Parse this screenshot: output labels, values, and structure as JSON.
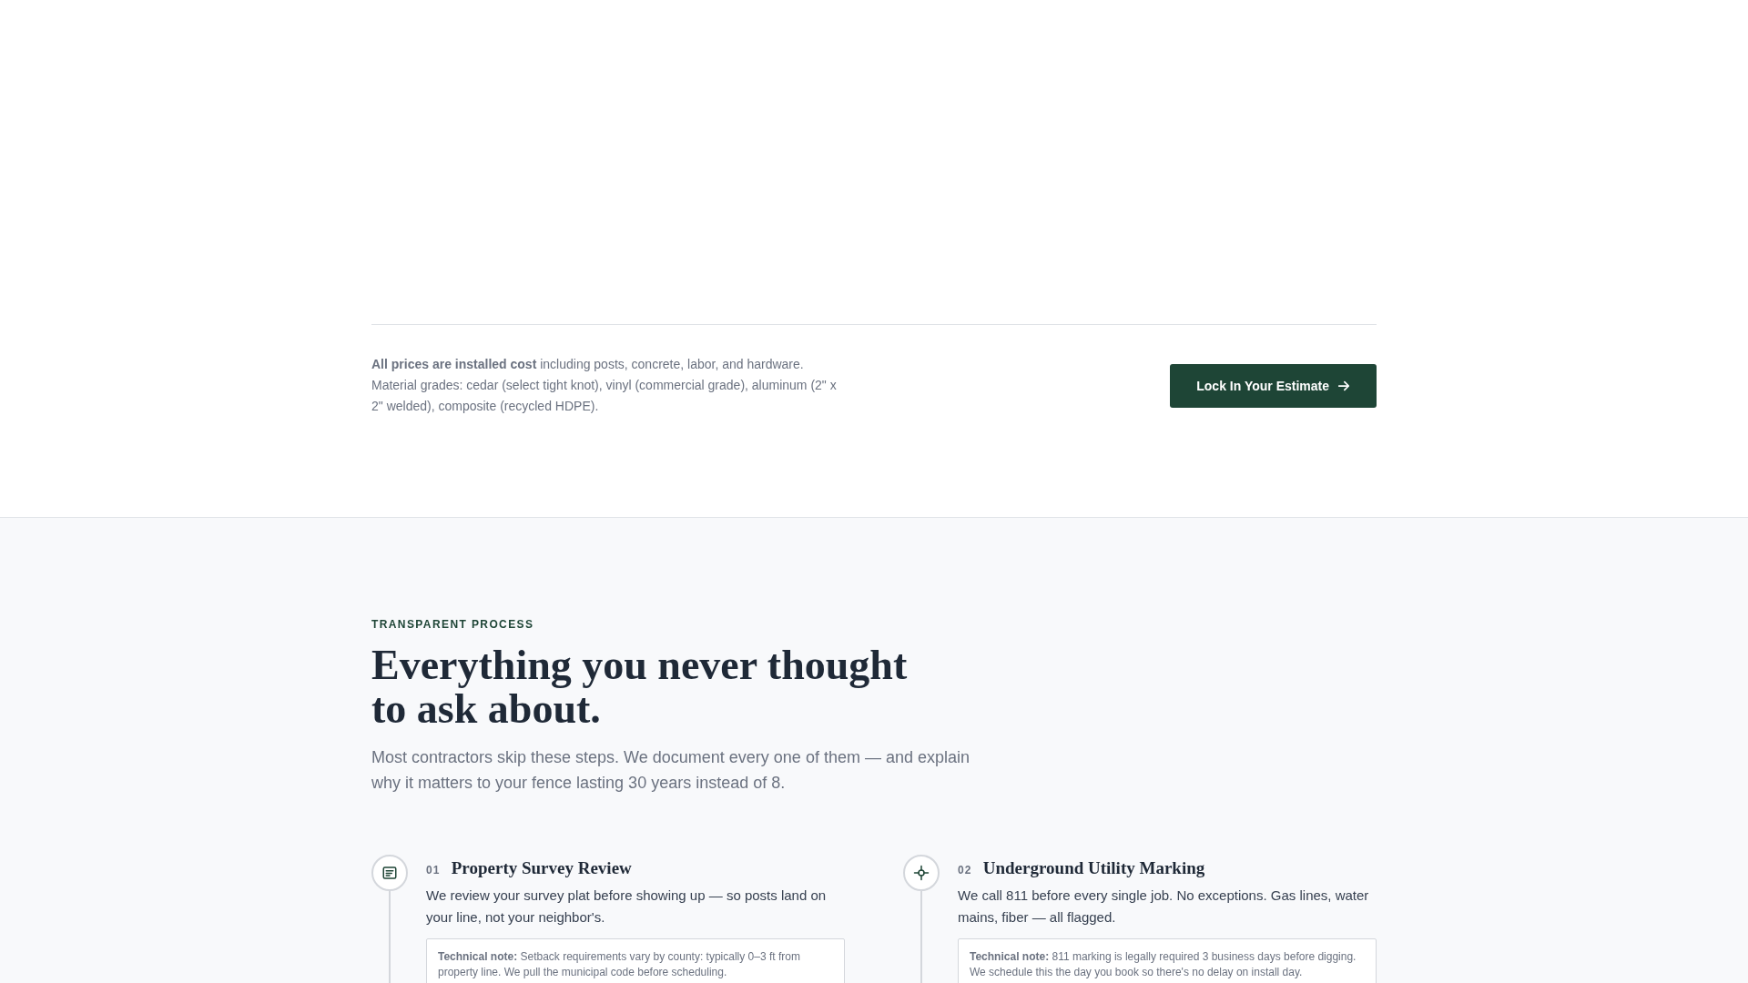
{
  "pricing_note": {
    "text": "**All prices are installed cost** including posts, concrete, labor, and hardware. Material grades: cedar (select tight knot), vinyl (commercial grade), aluminum (2\" x 2\" welded), composite (recycled HDPE).",
    "button": {
      "label": "Lock In Your Estimate"
    }
  },
  "process": {
    "eyebrow": "TRANSPARENT PROCESS",
    "heading": "Everything you never thought to ask about.",
    "intro": "Most contractors skip these steps. We document every one of them — and explain why it matters to your fence lasting 30 years instead of 8.",
    "steps": [
      {
        "number": "01",
        "title": "Property Survey Review",
        "description": "We review your survey plat before showing up — so posts land on your line, not your neighbor's.",
        "note": "**Technical note:** Setback requirements vary by county: typically 0–3 ft from property line. We pull the municipal code before scheduling."
      },
      {
        "number": "02",
        "title": "Underground Utility Marking",
        "description": "We call 811 before every single job. No exceptions. Gas lines, water mains, fiber — all flagged.",
        "note": "**Technical note:** 811 marking is legally required 3 business days before digging. We schedule this the day you book so there's no delay on install day."
      }
    ]
  }
}
